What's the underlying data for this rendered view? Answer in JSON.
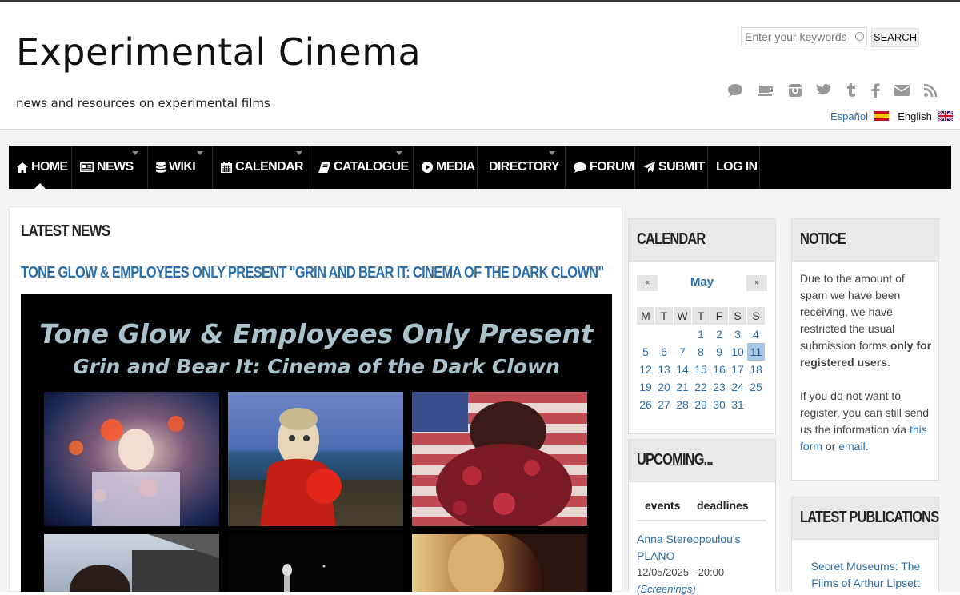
{
  "site": {
    "title": "Experimental Cinema",
    "subtitle": "news and resources on experimental films"
  },
  "search": {
    "placeholder": "Enter your keywords",
    "button": "SEARCH"
  },
  "social_icons": [
    "chat-icon",
    "coffee-icon",
    "instagram-icon",
    "twitter-icon",
    "tumblr-icon",
    "facebook-icon",
    "mail-icon",
    "rss-icon"
  ],
  "languages": {
    "spanish": "Español",
    "english": "English"
  },
  "nav": {
    "items": [
      {
        "label": "HOME",
        "icon": "home-icon"
      },
      {
        "label": "NEWS",
        "icon": "newspaper-icon"
      },
      {
        "label": "WIKI",
        "icon": "database-icon"
      },
      {
        "label": "CALENDAR",
        "icon": "calendar-icon"
      },
      {
        "label": "CATALOGUE",
        "icon": "book-icon"
      },
      {
        "label": "MEDIA",
        "icon": "play-icon"
      },
      {
        "label": "DIRECTORY",
        "icon": ""
      },
      {
        "label": "FORUM",
        "icon": "chat-icon"
      },
      {
        "label": "SUBMIT",
        "icon": "paper-plane-icon"
      },
      {
        "label": "LOG IN",
        "icon": ""
      }
    ]
  },
  "main": {
    "heading": "LATEST NEWS",
    "article": {
      "title": "TONE GLOW & EMPLOYEES ONLY PRESENT \"GRIN AND BEAR IT: CINEMA OF THE DARK CLOWN\"",
      "poster_line1": "Tone Glow & Employees Only Present",
      "poster_line2": "Grin and Bear It: Cinema of the Dark Clown"
    }
  },
  "calendar": {
    "title": "CALENDAR",
    "month": "May",
    "prev": "«",
    "next": "»",
    "weekdays": [
      "M",
      "T",
      "W",
      "T",
      "F",
      "S",
      "S"
    ],
    "days": [
      [
        "",
        "",
        "",
        "1",
        "2",
        "3",
        "4"
      ],
      [
        "5",
        "6",
        "7",
        "8",
        "9",
        "10",
        "11"
      ],
      [
        "12",
        "13",
        "14",
        "15",
        "16",
        "17",
        "18"
      ],
      [
        "19",
        "20",
        "21",
        "22",
        "23",
        "24",
        "25"
      ],
      [
        "26",
        "27",
        "28",
        "29",
        "30",
        "31",
        ""
      ]
    ],
    "today": "11"
  },
  "upcoming": {
    "title": "UPCOMING...",
    "tab_events": "events",
    "tab_deadlines": "deadlines",
    "event": {
      "title": "Anna Stereopoulou's PLANO",
      "date": "12/05/2025 - 20:00",
      "category": "(Screenings)"
    }
  },
  "notice": {
    "title": "NOTICE",
    "p1_start": "Due to the amount of spam we have been receiving, we have restricted the usual submission forms ",
    "p1_bold": "only for registered users",
    "p1_end": ".",
    "p2_start": "If you do not want to register, you can still send us the information via ",
    "p2_link1": "this form",
    "p2_mid": " or ",
    "p2_link2": "email",
    "p2_end": "."
  },
  "publications": {
    "title": "LATEST PUBLICATIONS",
    "item": "Secret Museums: The Films of Arthur Lipsett"
  },
  "colors": {
    "link": "#2b6ea8",
    "nav_bg": "#000000",
    "today_bg": "#a9c6e4"
  }
}
